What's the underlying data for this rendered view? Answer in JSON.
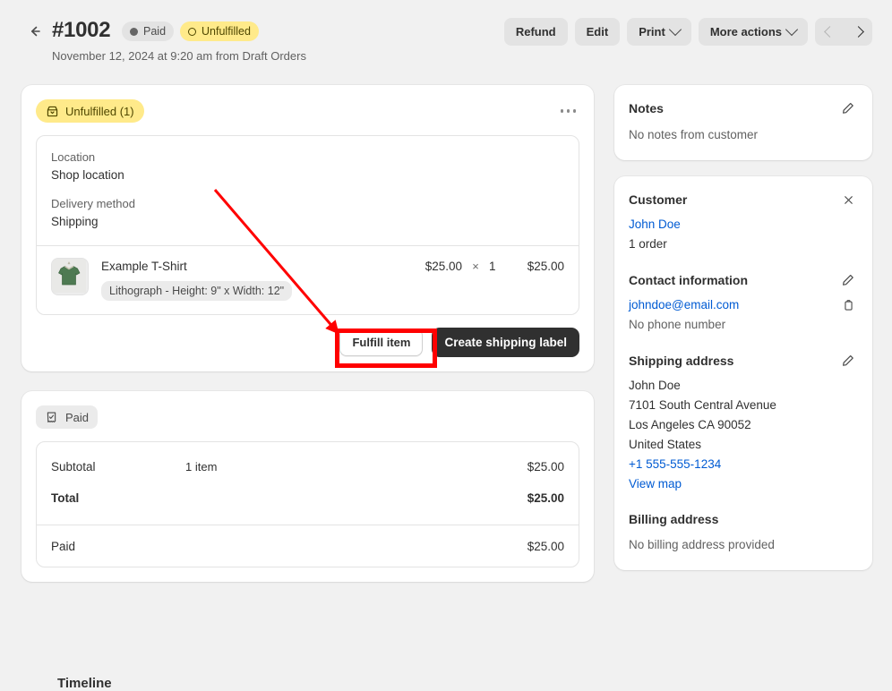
{
  "header": {
    "back_icon": "arrow-left-icon",
    "order_number": "#1002",
    "badges": [
      {
        "label": "Paid",
        "style": "gray",
        "icon": "solid-dot-icon"
      },
      {
        "label": "Unfulfilled",
        "style": "yellow",
        "icon": "hollow-circle-icon"
      }
    ],
    "subtitle": "November 12, 2024 at 9:20 am from Draft Orders",
    "actions": {
      "refund": "Refund",
      "edit": "Edit",
      "print": "Print",
      "more_actions": "More actions",
      "prev_icon": "chevron-left-icon",
      "next_icon": "chevron-right-icon"
    }
  },
  "fulfillment": {
    "status_badge": "Unfulfilled (1)",
    "status_icon": "package-icon",
    "menu_icon": "kebab-menu-icon",
    "location_label": "Location",
    "location_value": "Shop location",
    "delivery_label": "Delivery method",
    "delivery_value": "Shipping",
    "line_item": {
      "thumbnail_icon": "tshirt-product-image",
      "title": "Example T-Shirt",
      "variant": "Lithograph - Height: 9\" x Width: 12\"",
      "unit_price": "$25.00",
      "multiply_symbol": "×",
      "quantity": "1",
      "total": "$25.00"
    },
    "fulfill_button": "Fulfill item",
    "shipping_label_button": "Create shipping label"
  },
  "payment": {
    "status_badge": "Paid",
    "status_icon": "receipt-check-icon",
    "rows": [
      {
        "label": "Subtotal",
        "detail": "1 item",
        "amount": "$25.00"
      },
      {
        "label": "Total",
        "detail": "",
        "amount": "$25.00"
      },
      {
        "label": "Paid",
        "detail": "",
        "amount": "$25.00"
      }
    ]
  },
  "notes": {
    "title": "Notes",
    "edit_icon": "pencil-icon",
    "body": "No notes from customer"
  },
  "customer": {
    "title": "Customer",
    "close_icon": "close-icon",
    "name": "John Doe",
    "order_count": "1 order",
    "contact_title": "Contact information",
    "contact_edit_icon": "pencil-icon",
    "email": "johndoe@email.com",
    "copy_icon": "clipboard-copy-icon",
    "phone_status": "No phone number",
    "shipping_title": "Shipping address",
    "shipping_edit_icon": "pencil-icon",
    "shipping_address": [
      "John Doe",
      "7101 South Central Avenue",
      "Los Angeles CA 90052",
      "United States"
    ],
    "shipping_phone": "+1 555-555-1234",
    "view_map": "View map",
    "billing_title": "Billing address",
    "billing_body": "No billing address provided"
  },
  "timeline": {
    "title": "Timeline"
  },
  "annotation": {
    "highlight_target": "Fulfill item",
    "color": "#FF0000"
  },
  "colors": {
    "page_background": "#F1F1F1",
    "card_background": "#FFFFFF",
    "accent_link": "#005BD3",
    "warning_badge": "#FFEA8A",
    "dark_button": "#303030",
    "annotation": "#FF0000"
  }
}
